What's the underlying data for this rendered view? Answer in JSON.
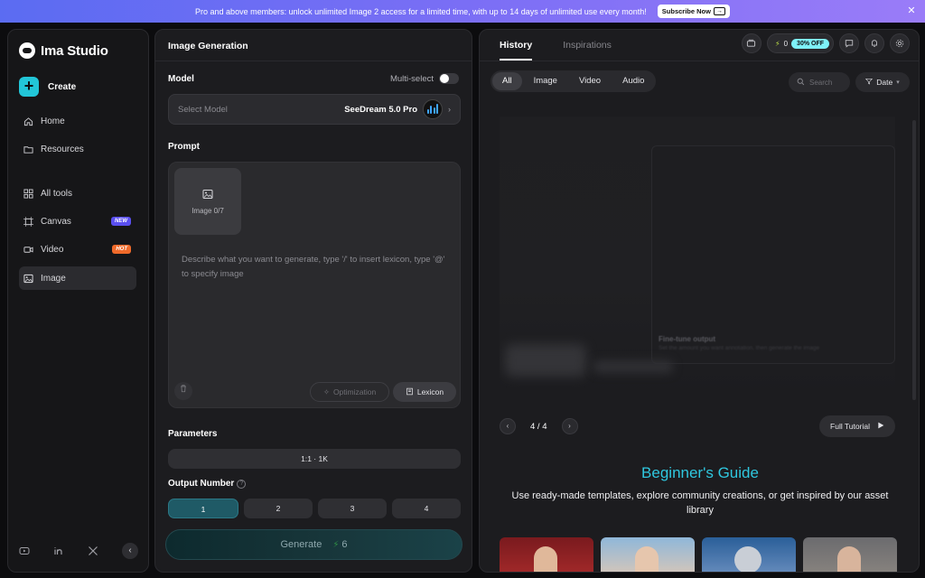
{
  "banner": {
    "message": "Pro and above members: unlock unlimited Image 2 access for a limited time, with up to 14 days of unlimited use every month!",
    "cta": "Subscribe Now",
    "cta_arrow": "→",
    "close": "✕"
  },
  "sidebar": {
    "brand": "Ima Studio",
    "create": "Create",
    "items": [
      {
        "label": "Home",
        "icon": "home-icon"
      },
      {
        "label": "Resources",
        "icon": "folder-icon"
      },
      {
        "label": "All tools",
        "icon": "grid-icon"
      },
      {
        "label": "Canvas",
        "icon": "canvas-icon",
        "badge": "NEW"
      },
      {
        "label": "Video",
        "icon": "video-icon",
        "badge": "HOT"
      },
      {
        "label": "Image",
        "icon": "image-icon",
        "active": true
      }
    ],
    "collapse": "‹"
  },
  "generation": {
    "title": "Image Generation",
    "model_label": "Model",
    "multi_select": "Multi-select",
    "model_placeholder": "Select Model",
    "model_value": "SeeDream 5.0 Pro",
    "prompt_label": "Prompt",
    "image_slot": "Image 0/7",
    "prompt_placeholder": "Describe what you want to generate, type '/' to insert lexicon, type '@' to specify image",
    "optimization": "Optimization",
    "lexicon": "Lexicon",
    "parameters_label": "Parameters",
    "ratio": "1:1 · 1K",
    "output_label": "Output Number",
    "output_options": [
      "1",
      "2",
      "3",
      "4"
    ],
    "output_selected": "1",
    "generate": "Generate",
    "generate_cost": "6"
  },
  "history": {
    "tabs": [
      "History",
      "Inspirations"
    ],
    "active_tab": "History",
    "credits": "0",
    "discount": "30% OFF",
    "filters": [
      "All",
      "Image",
      "Video",
      "Audio"
    ],
    "active_filter": "All",
    "search_placeholder": "Search",
    "date": "Date",
    "preview_title": "Fine-tune output",
    "preview_sub": "Set the amount you want annotation, then generate the image",
    "page": "4 / 4",
    "tutorial": "Full Tutorial",
    "guide_title": "Beginner's Guide",
    "guide_desc": "Use ready-made templates, explore community creations, or get inspired by our asset library"
  },
  "colors": {
    "accent": "#22c6d8",
    "new_badge": "#5a4ff0",
    "hot_badge": "#f06a2a",
    "discount": "#7ef0f7",
    "guide_title": "#2fc7df"
  }
}
